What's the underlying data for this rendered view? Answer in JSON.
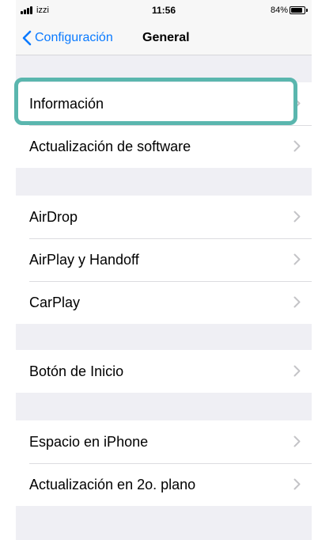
{
  "status_bar": {
    "carrier": "izzi",
    "time": "11:56",
    "battery_percent": "84%"
  },
  "nav": {
    "back_label": "Configuración",
    "title": "General"
  },
  "groups": [
    {
      "items": [
        {
          "label": "Información"
        },
        {
          "label": "Actualización de software"
        }
      ]
    },
    {
      "items": [
        {
          "label": "AirDrop"
        },
        {
          "label": "AirPlay y Handoff"
        },
        {
          "label": "CarPlay"
        }
      ]
    },
    {
      "items": [
        {
          "label": "Botón de Inicio"
        }
      ]
    },
    {
      "items": [
        {
          "label": "Espacio en iPhone"
        },
        {
          "label": "Actualización en 2o. plano"
        }
      ]
    }
  ],
  "colors": {
    "accent": "#0a7aff",
    "highlight": "#5ab6ae",
    "background": "#efeff4",
    "separator": "#dcdce0"
  }
}
